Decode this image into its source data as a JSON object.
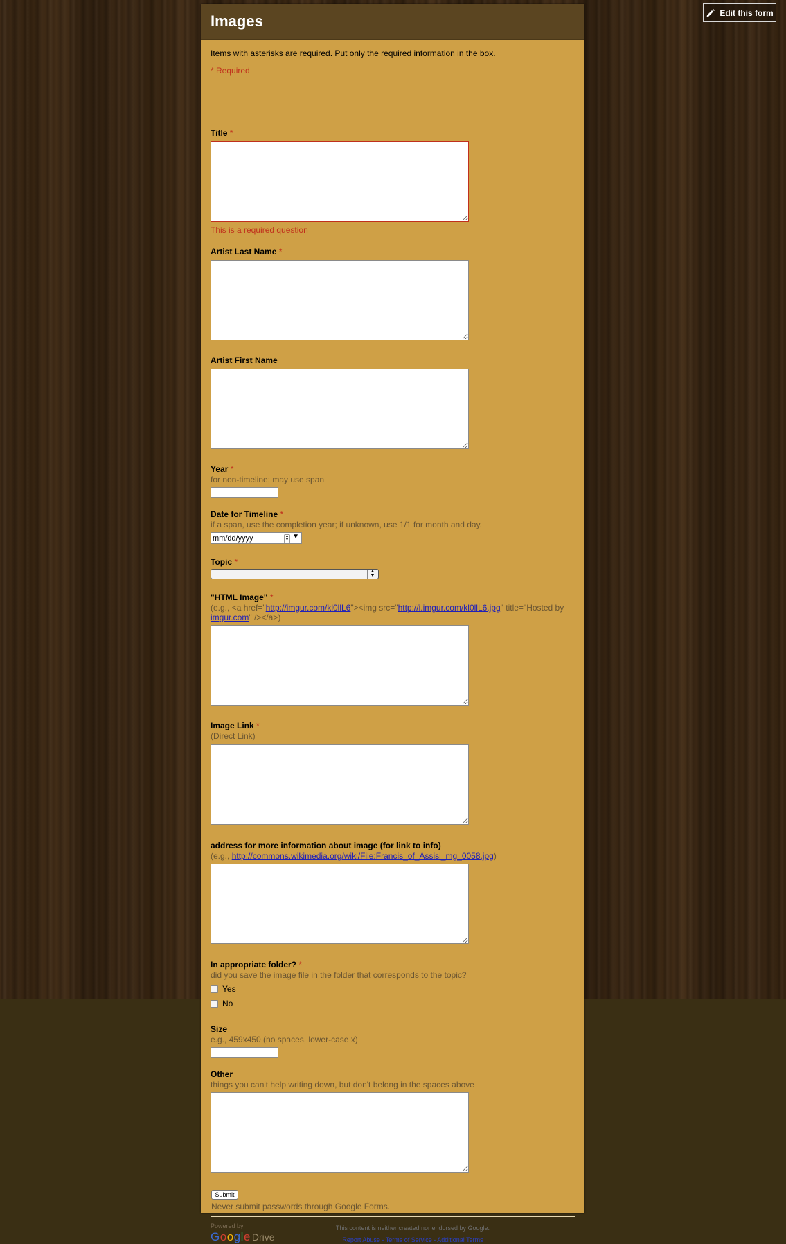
{
  "edit_button": {
    "label": "Edit this form",
    "icon": "pencil-icon"
  },
  "form": {
    "title": "Images",
    "intro": "Items with asterisks are required. Put only the required information in the box.",
    "required_note": "* Required",
    "fields": {
      "title": {
        "label": "Title",
        "star": "*",
        "error": "This is a required question"
      },
      "artist_last": {
        "label": "Artist Last Name",
        "star": "*"
      },
      "artist_first": {
        "label": "Artist First Name"
      },
      "year": {
        "label": "Year",
        "star": "*",
        "help": "for non-timeline; may use span"
      },
      "date_timeline": {
        "label": "Date for Timeline",
        "star": "*",
        "help": "if a span, use the completion year; if unknown, use 1/1 for month and day.",
        "placeholder": "mm/dd/yyyy"
      },
      "topic": {
        "label": "Topic",
        "star": "*"
      },
      "html_image": {
        "label": "\"HTML Image\"",
        "star": "*",
        "help_p1": "(e.g., <a href=\"",
        "link1": "http://imgur.com/kl0llL6",
        "help_p2": "\"><img src=\"",
        "link2": "http://i.imgur.com/kl0llL6.jpg",
        "help_p3": "\" title=\"Hosted by",
        "link3": "imgur.com",
        "help_p4": "\" /></a>)"
      },
      "image_link": {
        "label": "Image Link",
        "star": "*",
        "help": "(Direct Link)"
      },
      "more_info": {
        "label": "address for more information about image (for link to info)",
        "help_p1": "(e.g.,",
        "link": "http://commons.wikimedia.org/wiki/File:Francis_of_Assisi_mg_0058.jpg",
        "help_p2": ")"
      },
      "folder": {
        "label": "In appropriate folder?",
        "star": "*",
        "help": "did you save the image file in the folder that corresponds to the topic?",
        "options": [
          "Yes",
          "No"
        ]
      },
      "size": {
        "label": "Size",
        "help": "e.g., 459x450 (no spaces, lower-case x)"
      },
      "other": {
        "label": "Other",
        "help": "things you can't help writing down, but don't belong in the spaces above"
      }
    },
    "submit_label": "Submit",
    "password_warning": "Never submit passwords through Google Forms."
  },
  "footer": {
    "powered_by": "Powered by",
    "google_letters": [
      "G",
      "o",
      "o",
      "g",
      "l",
      "e"
    ],
    "drive": "Drive",
    "disclaimer": "This content is neither created nor endorsed by Google.",
    "links": [
      "Report Abuse",
      "Terms of Service",
      "Additional Terms"
    ],
    "separator": " - "
  },
  "colors": {
    "form_bg": "#cfa046",
    "header_bg": "#5b4521",
    "required_red": "#c0301c",
    "link_blue": "#2020b8"
  }
}
